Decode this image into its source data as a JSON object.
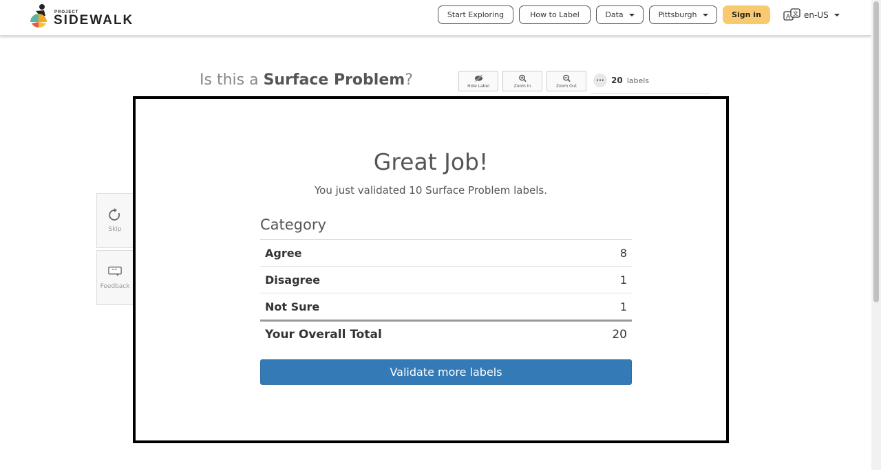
{
  "brand": {
    "small": "PROJECT",
    "name": "SIDEWALK"
  },
  "nav": {
    "start_exploring": "Start Exploring",
    "how_to_label": "How to Label",
    "data": "Data",
    "city": "Pittsburgh",
    "sign_in": "Sign in",
    "language": "en-US"
  },
  "validate": {
    "question_prefix": "Is this a ",
    "label_type": "Surface Problem",
    "question_suffix": "?",
    "tools": {
      "hide_label": "Hide Label",
      "zoom_in": "Zoom In",
      "zoom_out": "Zoom Out"
    },
    "labels_count": "20",
    "labels_word": "labels"
  },
  "side": {
    "skip": "Skip",
    "feedback": "Feedback"
  },
  "modal": {
    "title": "Great Job!",
    "subtitle": "You just validated 10 Surface Problem labels.",
    "category_header": "Category",
    "rows": [
      {
        "label": "Agree",
        "value": "8"
      },
      {
        "label": "Disagree",
        "value": "1"
      },
      {
        "label": "Not Sure",
        "value": "1"
      }
    ],
    "total": {
      "label": "Your Overall Total",
      "value": "20"
    },
    "button": "Validate more labels"
  },
  "colors": {
    "accent": "#337ab7",
    "signin": "#f9c970",
    "modal_border": "#000000"
  }
}
